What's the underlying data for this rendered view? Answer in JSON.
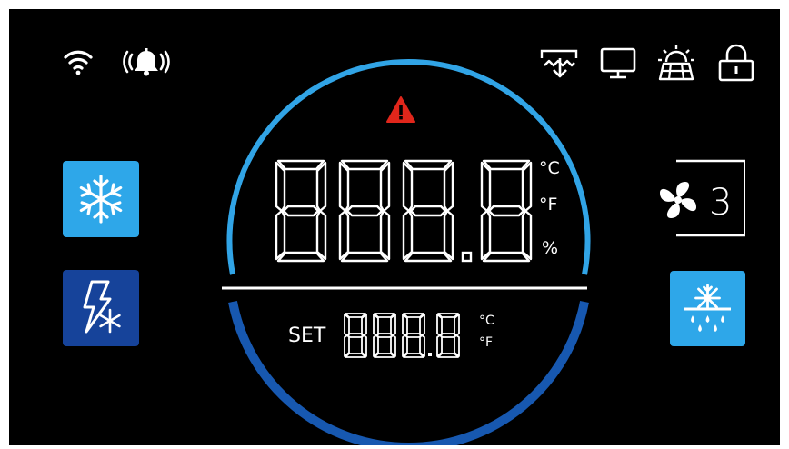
{
  "status_icons": {
    "left": [
      "wifi-icon",
      "alarm-bell-icon"
    ],
    "right": [
      "defrost-drain-icon",
      "monitor-icon",
      "solar-heater-icon",
      "lock-icon"
    ]
  },
  "main_display": {
    "value": "888.8",
    "units": [
      "°C",
      "°F",
      "%"
    ],
    "warning_icon": "warning-triangle-icon"
  },
  "set_display": {
    "label": "SET",
    "value": "888.8",
    "units": [
      "°C",
      "°F"
    ]
  },
  "fan": {
    "icon": "fan-icon",
    "speed": "3"
  },
  "buttons": {
    "left": [
      "snowflake-icon",
      "quick-freeze-icon"
    ],
    "right": [
      "defrost-icon"
    ]
  },
  "colors": {
    "background": "#000000",
    "ring_light": "#31a4e6",
    "ring_dark": "#1758b0",
    "button_light": "#2ea7e9",
    "button_dark": "#16439a",
    "warning": "#e0261b",
    "segment": "#ffffff"
  }
}
